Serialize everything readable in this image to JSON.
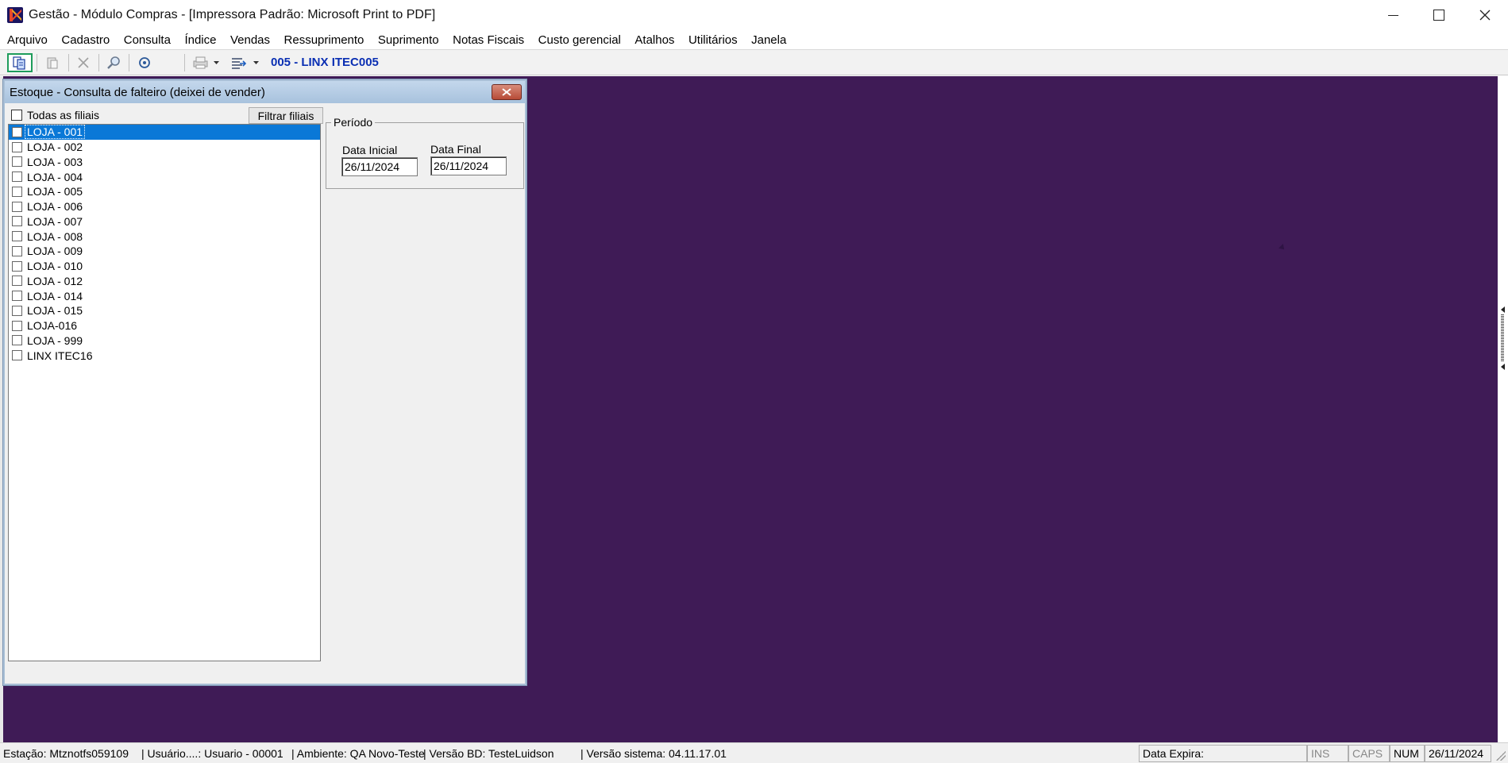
{
  "window": {
    "title": "Gestão  - Módulo Compras - [Impressora Padrão: Microsoft Print to PDF]"
  },
  "menu": [
    "Arquivo",
    "Cadastro",
    "Consulta",
    "Índice",
    "Vendas",
    "Ressuprimento",
    "Suprimento",
    "Notas Fiscais",
    "Custo gerencial",
    "Atalhos",
    "Utilitários",
    "Janela"
  ],
  "toolbar": {
    "company_label": "005 - LINX ITEC005",
    "icons": [
      "new-record-icon",
      "paste-icon",
      "delete-icon",
      "search-icon",
      "target-icon",
      "print-icon",
      "export-icon"
    ]
  },
  "child_window": {
    "title": "Estoque - Consulta de falteiro (deixei de vender)",
    "all_branches_label": "Todas as filiais",
    "filter_button": "Filtrar filiais",
    "branches": [
      {
        "label": "LOJA - 001",
        "selected": true
      },
      {
        "label": "LOJA - 002",
        "selected": false
      },
      {
        "label": "LOJA - 003",
        "selected": false
      },
      {
        "label": "LOJA - 004",
        "selected": false
      },
      {
        "label": "LOJA - 005",
        "selected": false
      },
      {
        "label": "LOJA - 006",
        "selected": false
      },
      {
        "label": "LOJA - 007",
        "selected": false
      },
      {
        "label": "LOJA - 008",
        "selected": false
      },
      {
        "label": "LOJA - 009",
        "selected": false
      },
      {
        "label": "LOJA - 010",
        "selected": false
      },
      {
        "label": "LOJA - 012",
        "selected": false
      },
      {
        "label": "LOJA - 014",
        "selected": false
      },
      {
        "label": "LOJA - 015",
        "selected": false
      },
      {
        "label": "LOJA-016",
        "selected": false
      },
      {
        "label": "LOJA - 999",
        "selected": false
      },
      {
        "label": "LINX ITEC16",
        "selected": false
      }
    ],
    "period": {
      "legend": "Período",
      "start_label": "Data Inicial",
      "start_value": "26/11/2024",
      "end_label": "Data Final",
      "end_value": "26/11/2024"
    }
  },
  "status": {
    "estacao": "Estação: Mtznotfs059109",
    "usuario": "| Usuário....: Usuario - 00001",
    "ambiente": "| Ambiente: QA Novo-Teste",
    "versao_bd": "| Versão BD: TesteLuidson",
    "versao_sistema": "| Versão sistema: 04.11.17.01",
    "data_expira": "Data Expira:",
    "ins": "INS",
    "caps": "CAPS",
    "num": "NUM",
    "date": "26/11/2024"
  },
  "colors": {
    "mdi_background": "#3f1b56",
    "selection": "#0a78d7",
    "company_label": "#0a2fb3",
    "first_button_border": "#1e9c5b"
  }
}
